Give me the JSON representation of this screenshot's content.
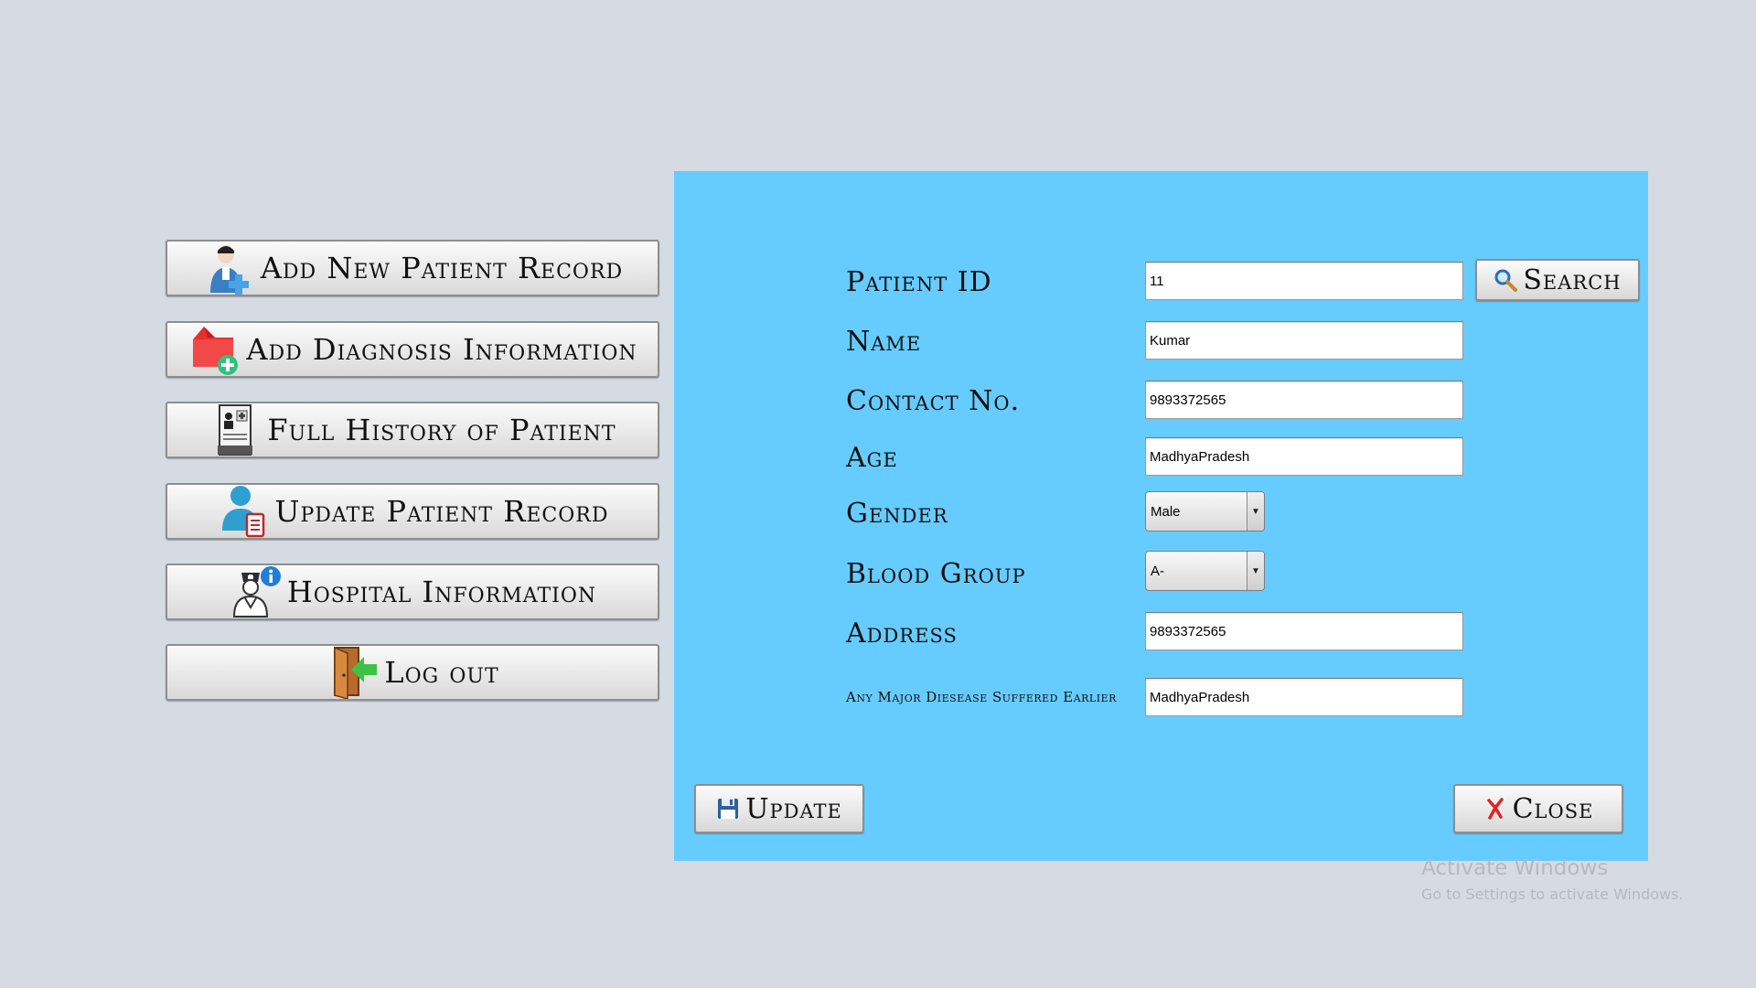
{
  "nav": {
    "add_new_patient_record": "Add New Patient Record",
    "add_diagnosis_information": "Add Diagnosis Information",
    "full_history_of_patient": "Full History of Patient",
    "update_patient_record": "Update Patient Record",
    "hospital_information": "Hospital Information",
    "log_out": "Log out"
  },
  "form": {
    "patient_id": {
      "label": "Patient ID",
      "value": "11"
    },
    "search_label": "Search",
    "name": {
      "label": "Name",
      "value": "Kumar"
    },
    "contact": {
      "label": "Contact No.",
      "value": "9893372565"
    },
    "age": {
      "label": "Age",
      "value": "MadhyaPradesh"
    },
    "gender": {
      "label": "Gender",
      "value": "Male"
    },
    "blood_group": {
      "label": "Blood Group",
      "value": "A-"
    },
    "address": {
      "label": "Address",
      "value": "9893372565"
    },
    "major_disease": {
      "label": "Any Major Diesease Suffered Earlier",
      "value": "MadhyaPradesh"
    },
    "update_label": "Update",
    "close_label": "Close"
  },
  "watermark": {
    "title": "Activate Windows",
    "subtitle": "Go to Settings to activate Windows."
  },
  "colors": {
    "background": "#d6dae2",
    "panel": "#66ccff",
    "button_face": "#ececec",
    "watermark": "#b6b9bf"
  },
  "icons": {
    "add_new_patient_record": "doctor-plus-icon",
    "add_diagnosis_information": "red-folder-plus-icon",
    "full_history_of_patient": "patient-file-icon",
    "update_patient_record": "user-clipboard-icon",
    "hospital_information": "nurse-info-icon",
    "log_out": "door-exit-icon",
    "search": "magnifier-icon",
    "update": "floppy-disk-icon",
    "close": "red-x-icon"
  }
}
